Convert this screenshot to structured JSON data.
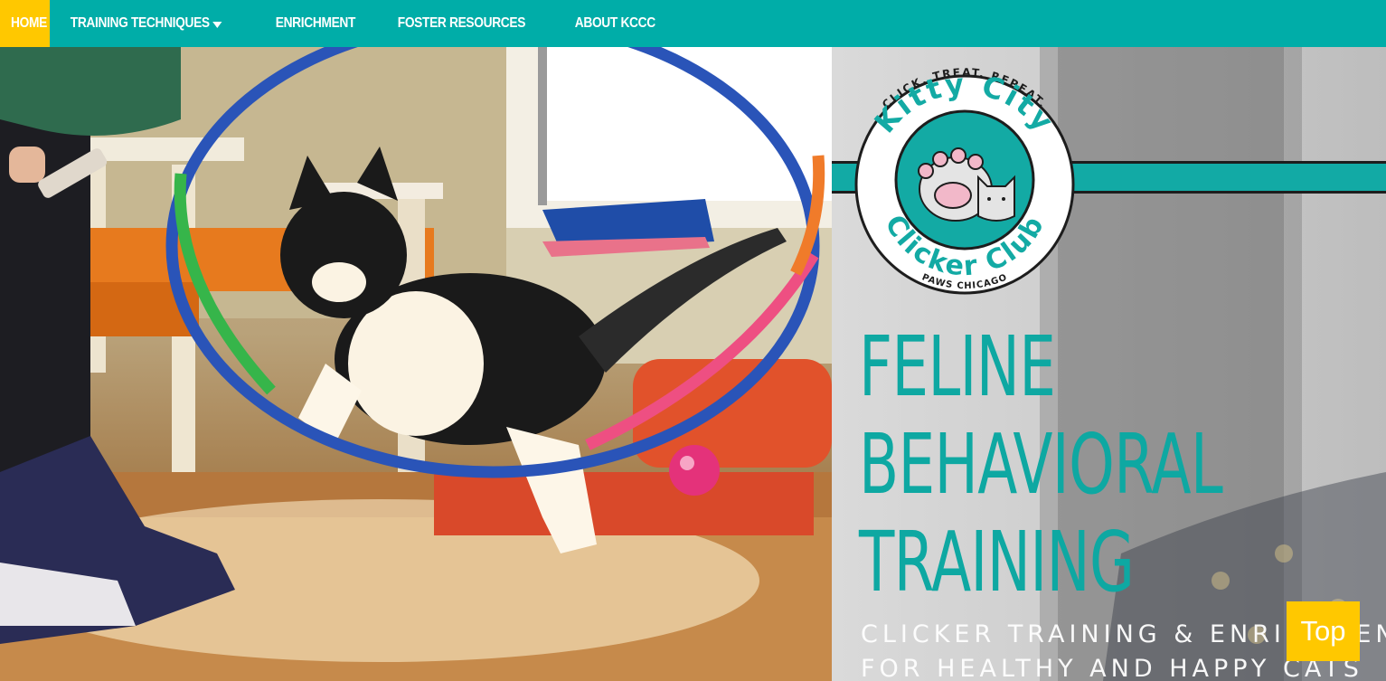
{
  "nav": {
    "items": [
      {
        "label": "Home",
        "active": true
      },
      {
        "label": "Training Techniques",
        "has_dropdown": true
      },
      {
        "label": "Enrichment"
      },
      {
        "label": "Foster Resources"
      },
      {
        "label": "About KCCC"
      }
    ]
  },
  "logo": {
    "top_text": "CLICK. TREAT. REPEAT.",
    "name_top": "Kitty City",
    "name_bottom": "Clicker Club",
    "bottom_text": "PAWS CHICAGO"
  },
  "hero": {
    "headline": [
      "FELINE",
      "BEHAVIORAL",
      "TRAINING"
    ],
    "subline1": "CLICKER TRAINING & ENRICHMENT",
    "subline2": "FOR HEALTHY AND HAPPY CATS"
  },
  "top_button": {
    "label": "Top"
  },
  "colors": {
    "nav": "#00ada8",
    "nav_active": "#ffc800",
    "teal": "#0ea8a2",
    "top_button": "#ffc800"
  }
}
